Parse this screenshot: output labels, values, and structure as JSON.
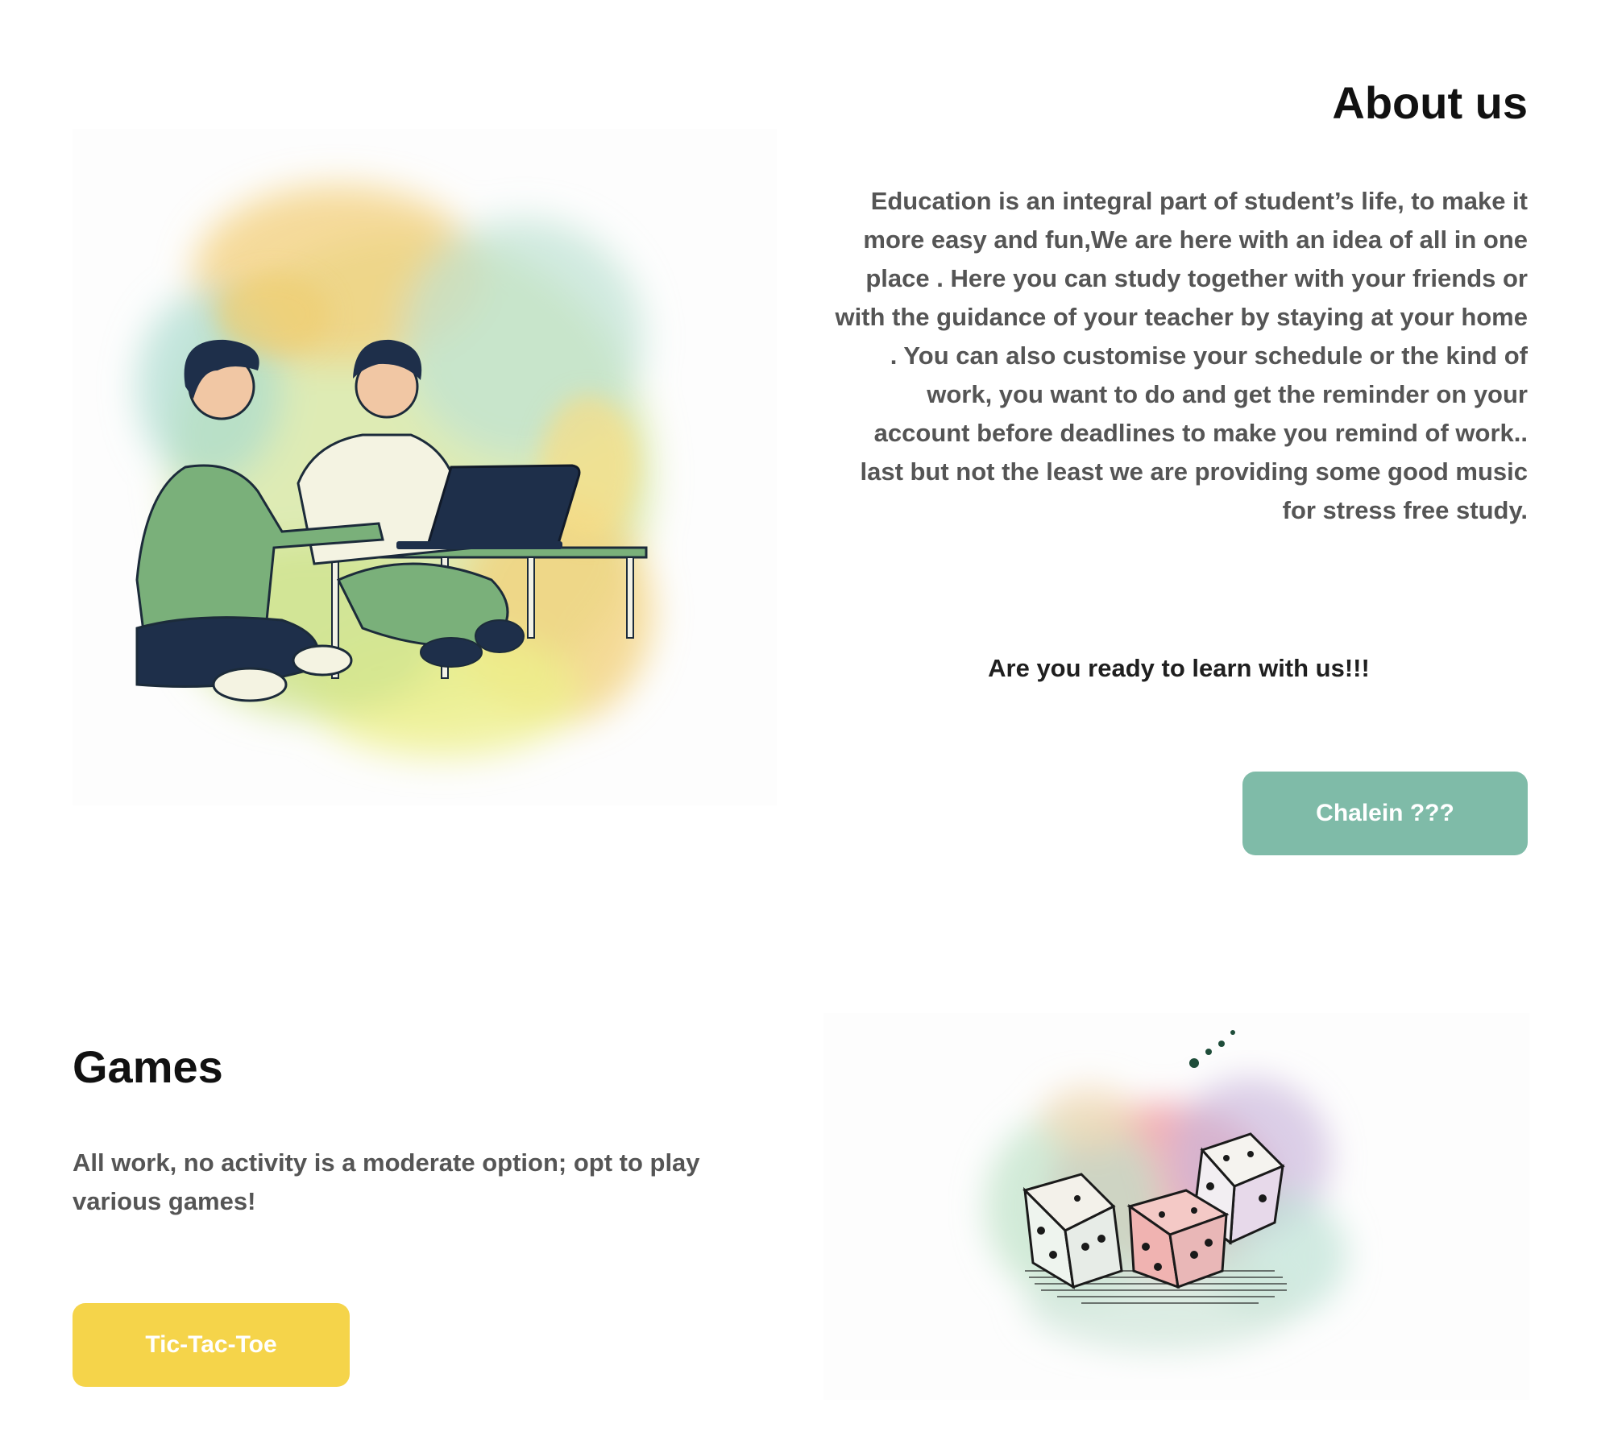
{
  "about": {
    "title": "About us",
    "paragraph": "Education is an integral part of student’s life, to make it more easy and fun,We are here with an idea of all in one place . Here you can study together with your friends or with the guidance of your teacher by staying at your home . You can also customise your schedule or the kind of work, you want to do and get the reminder on your account before deadlines to make you remind of work.. last but not the least we are providing some good music for stress free study.",
    "cta_text": "Are you ready to learn with us!!!",
    "button_label": "Chalein ???",
    "button_color": "#7fbba8",
    "illustration": "two-students-with-laptop-illustration"
  },
  "games": {
    "title": "Games",
    "paragraph": "All work, no activity is a moderate option; opt to play various games!",
    "button_label": "Tic-Tac-Toe",
    "button_color": "#f5d44a",
    "illustration": "dice-watercolor-illustration"
  }
}
